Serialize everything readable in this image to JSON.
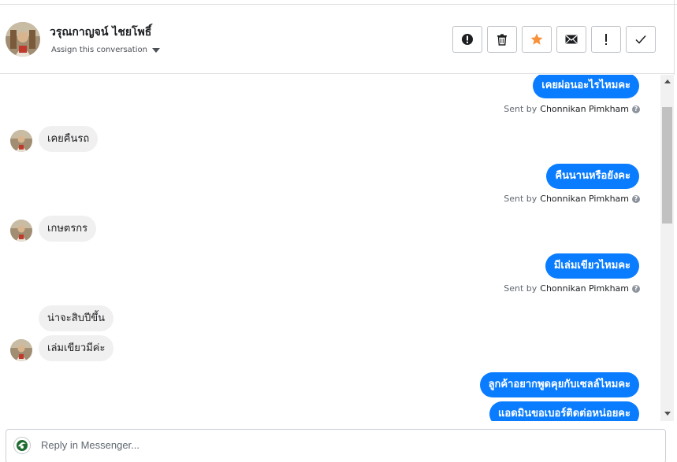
{
  "header": {
    "contact_name": "วรุณกาญจน์ ไชยโพธิ์",
    "assign_label": "Assign this conversation"
  },
  "toolbar": {
    "buttons": [
      {
        "icon": "alert-circle-icon"
      },
      {
        "icon": "trash-icon"
      },
      {
        "icon": "star-icon",
        "color": "#f7923b"
      },
      {
        "icon": "envelope-icon"
      },
      {
        "icon": "exclamation-icon"
      },
      {
        "icon": "checkmark-icon"
      }
    ]
  },
  "messages": [
    {
      "direction": "out",
      "text": "เคยผ่อนอะไรไหมคะ",
      "sent_by_prefix": "Sent by",
      "sent_by_name": "Chonnikan Pimkham"
    },
    {
      "direction": "in",
      "text": "เคยคืนรถ"
    },
    {
      "direction": "out",
      "text": "คืนนานหรือยังคะ",
      "sent_by_prefix": "Sent by",
      "sent_by_name": "Chonnikan Pimkham"
    },
    {
      "direction": "in",
      "text": "เกษตรกร"
    },
    {
      "direction": "out",
      "text": "มีเล่มเขียวไหมคะ",
      "sent_by_prefix": "Sent by",
      "sent_by_name": "Chonnikan Pimkham"
    },
    {
      "direction": "in",
      "text": "น่าจะสิบปีขึ้น"
    },
    {
      "direction": "in",
      "text": "เล่มเขียวมีค่ะ"
    },
    {
      "direction": "out",
      "text": "ลูกค้าอยากพูดคุยกับเซลล์ไหมคะ"
    },
    {
      "direction": "out",
      "text": "แอดมินขอเบอร์ติดต่อหน่อยคะ"
    }
  ],
  "help_glyph": "?",
  "reply": {
    "placeholder": "Reply in Messenger..."
  },
  "colors": {
    "outgoing_bubble": "#0a7cff",
    "incoming_bubble": "#f1f0f0",
    "star_accent": "#f7923b"
  }
}
